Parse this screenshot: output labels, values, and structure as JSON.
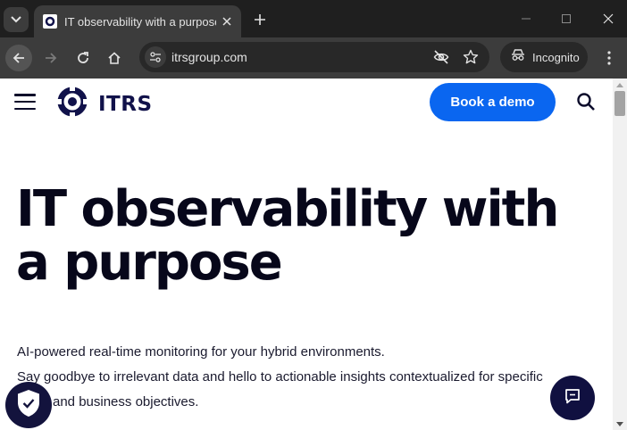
{
  "browser": {
    "tab": {
      "title": "IT observability with a purpose"
    },
    "address_bar": {
      "url": "itrsgroup.com"
    },
    "profile": {
      "label": "Incognito"
    }
  },
  "page": {
    "logo": {
      "text": "ITRS"
    },
    "header": {
      "cta_label": "Book a demo"
    },
    "hero": {
      "title": "IT observability with a purpose",
      "subtitle_line1": "AI-powered real-time monitoring for your hybrid environments.",
      "subtitle_line2": "Say goodbye to irrelevant data and hello to actionable insights contextualized for specific",
      "subtitle_line3": "and business objectives."
    }
  },
  "colors": {
    "brand_navy": "#11124a",
    "cta_blue": "#0a66f0",
    "chrome_dark": "#1f1f1f",
    "chrome_toolbar": "#3c3c3c"
  },
  "icons": [
    "tab-search-icon",
    "close-icon",
    "plus-icon",
    "minimize-icon",
    "maximize-icon",
    "back-icon",
    "forward-icon",
    "reload-icon",
    "home-icon",
    "site-settings-icon",
    "eye-off-icon",
    "star-icon",
    "incognito-icon",
    "kebab-menu-icon",
    "hamburger-icon",
    "itrs-logo-icon",
    "search-icon",
    "shield-check-icon",
    "chat-icon"
  ]
}
